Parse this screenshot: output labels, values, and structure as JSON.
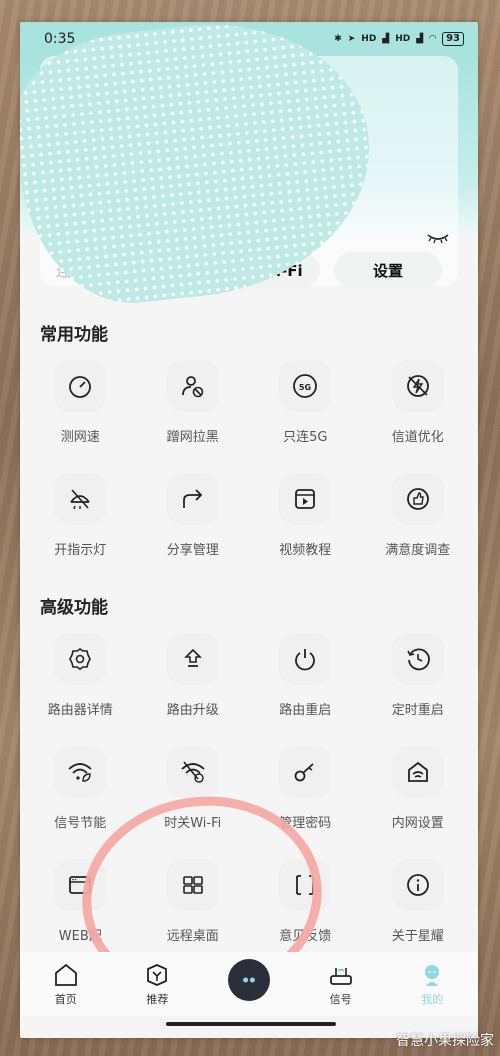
{
  "status_bar": {
    "time": "0:35",
    "network_1": "HD",
    "network_2": "HD",
    "battery": "93"
  },
  "wifi_card": {
    "connected_label": "连接设",
    "share_wifi_label": "分享Wi-Fi",
    "settings_label": "设置"
  },
  "common": {
    "title": "常用功能",
    "items": [
      {
        "label": "测网速",
        "icon": "speedometer-icon"
      },
      {
        "label": "蹭网拉黑",
        "icon": "user-block-icon"
      },
      {
        "label": "只连5G",
        "icon": "5g-icon"
      },
      {
        "label": "信道优化",
        "icon": "channel-optimize-icon"
      },
      {
        "label": "开指示灯",
        "icon": "indicator-light-icon"
      },
      {
        "label": "分享管理",
        "icon": "share-icon"
      },
      {
        "label": "视频教程",
        "icon": "video-icon"
      },
      {
        "label": "满意度调查",
        "icon": "thumbs-up-icon"
      }
    ]
  },
  "advanced": {
    "title": "高级功能",
    "items": [
      {
        "label": "路由器详情",
        "icon": "gear-icon"
      },
      {
        "label": "路由升级",
        "icon": "upgrade-icon"
      },
      {
        "label": "路由重启",
        "icon": "power-icon"
      },
      {
        "label": "定时重启",
        "icon": "timer-restart-icon"
      },
      {
        "label": "信号节能",
        "icon": "wifi-leaf-icon"
      },
      {
        "label": "时关Wi-Fi",
        "icon": "wifi-timer-icon"
      },
      {
        "label": "管理密码",
        "icon": "key-icon"
      },
      {
        "label": "内网设置",
        "icon": "home-network-icon"
      },
      {
        "label": "WEB配",
        "icon": "browser-icon"
      },
      {
        "label": "远程桌面",
        "icon": "remote-desktop-icon"
      },
      {
        "label": "意见反馈",
        "icon": "feedback-icon"
      },
      {
        "label": "关于星耀",
        "icon": "info-icon"
      }
    ]
  },
  "bottom_nav": {
    "home": "首页",
    "recommend": "推荐",
    "signal": "信号",
    "mine": "我的"
  },
  "watermark": "智慧小果探险家",
  "colors": {
    "accent": "#8fd8e2",
    "teal_band": "#a8e3de",
    "marker": "#f4a7a3"
  }
}
